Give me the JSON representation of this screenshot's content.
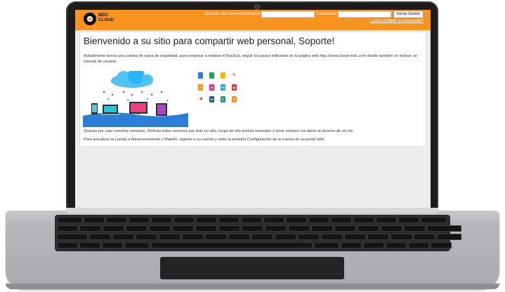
{
  "header": {
    "logo": {
      "line1": "MDC",
      "line2": "CLOUD"
    },
    "email_label": "Dirección De Correo Electrónico",
    "password_label": "Contraseña",
    "login_button": "Iniciar Sesión",
    "forgot_link": "¿¿Has olvidado tu contraseña?"
  },
  "main": {
    "title": "Bienvenido a su sitio para compartir web personal, Soporte!",
    "intro": "Actualmente tienes una cuenta de copia de seguridad, para empezar a realizar el BackUp, seguir los pasos indicados en la página web http://www.cloud-mdc.com donde también se incluye un manual de usuario.",
    "thanks": "Gracias por usar nuestros servicios. Disfruta estos servicios por todo un año, luego de ello podrás renovarlo y tener siempre tus datos al alcance de un clic.",
    "upgrade": "Para actualizar la cuenta a Almacenamiento y Maletín, ingrese a su cuenta y visite la pestaña Configuración de la cuenta de su portal web."
  },
  "file_icons": [
    {
      "name": "doc-icon",
      "color": "#2b7cd3"
    },
    {
      "name": "sheet-icon",
      "color": "#21a366"
    },
    {
      "name": "slides-icon",
      "color": "#f4b400"
    },
    {
      "name": "pdf-icon",
      "color": "#e53935"
    },
    {
      "name": "illustrator-icon",
      "color": "#f7931e"
    },
    {
      "name": "indesign-icon",
      "color": "#e0338a"
    },
    {
      "name": "photoshop-icon",
      "color": "#2fa4e7"
    },
    {
      "name": "image-icon",
      "color": "#e53935"
    },
    {
      "name": "audio-icon",
      "color": "#e53935"
    },
    {
      "name": "word-icon",
      "color": "#2b579a"
    },
    {
      "name": "excel-icon",
      "color": "#21a366"
    },
    {
      "name": "powerpoint-icon",
      "color": "#f7931e"
    }
  ],
  "colors": {
    "header_bg": "#f7931e",
    "cloud": "#4fc3f7",
    "desk": "#2e7dd7"
  }
}
